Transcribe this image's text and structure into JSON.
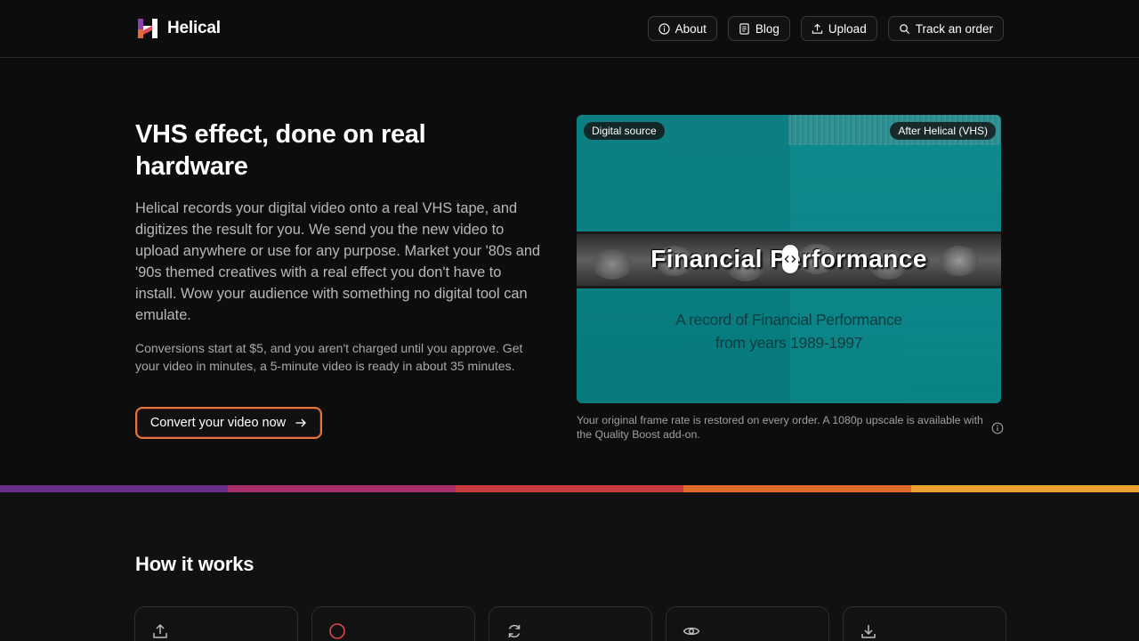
{
  "header": {
    "brand": "Helical",
    "nav": [
      {
        "label": "About",
        "icon": "info-icon"
      },
      {
        "label": "Blog",
        "icon": "document-icon"
      },
      {
        "label": "Upload",
        "icon": "upload-icon"
      },
      {
        "label": "Track an order",
        "icon": "search-icon"
      }
    ]
  },
  "hero": {
    "title": "VHS effect, done on real hardware",
    "lead": "Helical records your digital video onto a real VHS tape, and digitizes the result for you. We send you the new video to upload anywhere or use for any purpose. Market your '80s and '90s themed creatives with a real effect you don't have to install. Wow your audience with something no digital tool can emulate.",
    "note": "Conversions start at $5, and you aren't charged until you approve. Get your video in minutes, a 5-minute video is ready in about 35 minutes.",
    "cta_label": "Convert your video now"
  },
  "comparison": {
    "label_left": "Digital source",
    "label_right": "After Helical (VHS)",
    "video_title": "Financial Performance",
    "video_subtitle_1": "A record of Financial Performance",
    "video_subtitle_2": "from years 1989-1997",
    "caption": "Your original frame rate is restored on every order. A 1080p upscale is available with the Quality Boost add-on."
  },
  "stripe_colors": [
    "#6b2d8a",
    "#a8306a",
    "#c83a3e",
    "#e06a2e",
    "#eaa033"
  ],
  "how_it_works": {
    "title": "How it works",
    "steps": [
      {
        "icon": "upload-icon"
      },
      {
        "icon": "record-icon"
      },
      {
        "icon": "refresh-icon"
      },
      {
        "icon": "eye-icon"
      },
      {
        "icon": "download-icon"
      }
    ]
  },
  "colors": {
    "background": "#0d0d0d",
    "accent_orange": "#e6763a",
    "video_teal": "#0a8285"
  }
}
